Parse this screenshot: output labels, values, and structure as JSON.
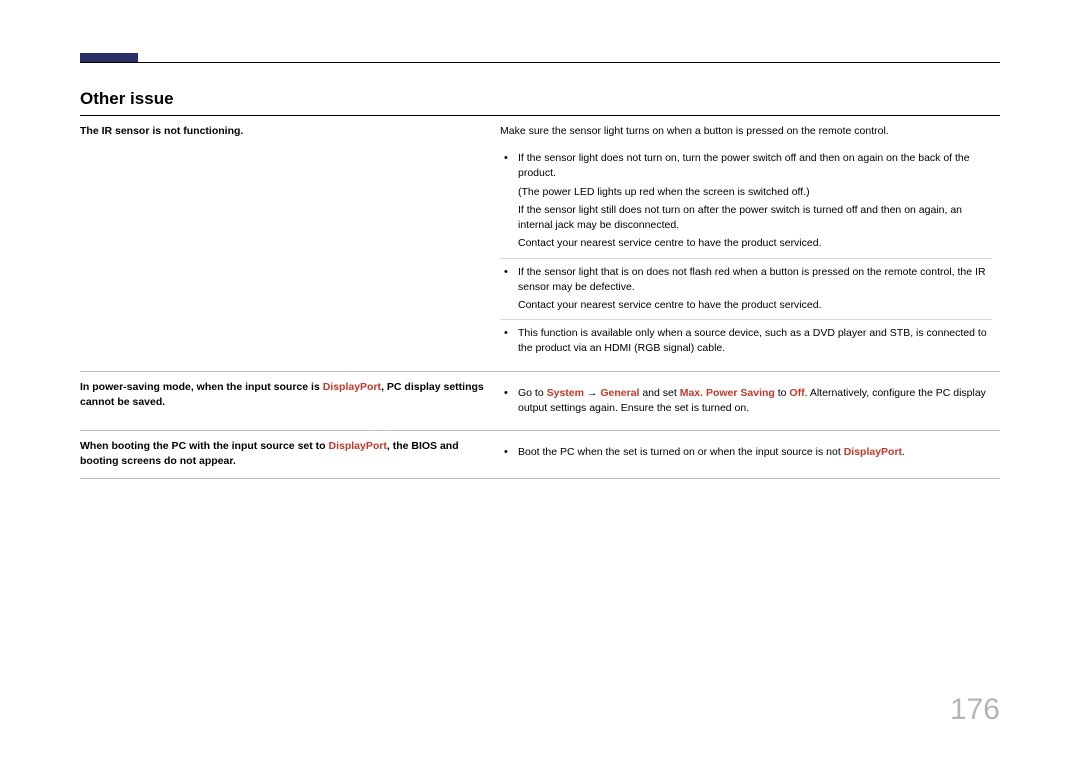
{
  "section_title": "Other issue",
  "page_number": "176",
  "row1": {
    "issue": "The IR sensor is not functioning.",
    "intro": "Make sure the sensor light turns on when a button is pressed on the remote control.",
    "b1a": "If the sensor light does not turn on, turn the power switch off and then on again on the back of the product.",
    "b1b": "(The power LED lights up red when the screen is switched off.)",
    "b1c": "If the sensor light still does not turn on after the power switch is turned off and then on again, an internal jack may be disconnected.",
    "b1d": "Contact your nearest service centre to have the product serviced.",
    "b2a": "If the sensor light that is on does not flash red when a button is pressed on the remote control, the IR sensor may be defective.",
    "b2b": "Contact your nearest service centre to have the product serviced.",
    "b3": "This function is available only when a source device, such as a DVD player and STB, is connected to the product via an HDMI (RGB signal) cable."
  },
  "row2": {
    "issue_p1": "In power-saving mode, when the input source is ",
    "issue_hl": "DisplayPort",
    "issue_p2": ", PC display settings cannot be saved.",
    "sol_p1": "Go to ",
    "sol_hl1": "System",
    "sol_arrow": " → ",
    "sol_hl2": "General",
    "sol_p2": " and set ",
    "sol_hl3": "Max. Power Saving",
    "sol_p3": " to ",
    "sol_hl4": "Off",
    "sol_p4": ". Alternatively, configure the PC display output settings again. Ensure the set is turned on."
  },
  "row3": {
    "issue_p1": "When booting the PC with the input source set to ",
    "issue_hl": "DisplayPort",
    "issue_p2": ", the BIOS and booting screens do not appear.",
    "sol_p1": "Boot the PC when the set is turned on or when the input source is not ",
    "sol_hl": "DisplayPort",
    "sol_p2": "."
  }
}
